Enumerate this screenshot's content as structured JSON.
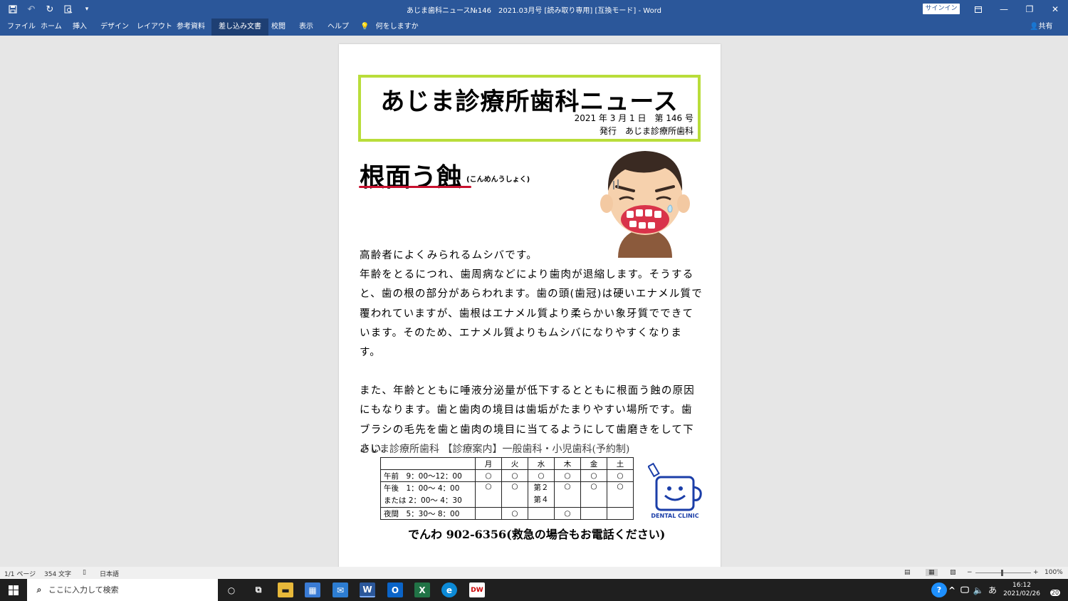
{
  "window": {
    "title": "あじま歯科ニュース№146　2021.03月号 [読み取り専用] [互換モード]  -  Word",
    "signin": "サインイン"
  },
  "ribbon": {
    "tabs": [
      "ファイル",
      "ホーム",
      "挿入",
      "デザイン",
      "レイアウト",
      "参考資料",
      "差し込み文書",
      "校閲",
      "表示",
      "ヘルプ"
    ],
    "tellme": "何をしますか",
    "share": "共有",
    "active_tab": "差し込み文書"
  },
  "document": {
    "masthead": "あじま診療所歯科ニュース",
    "date_line": "2021 年 3 月 1 日　第 146 号",
    "publisher_line": "発行　あじま診療所歯科",
    "heading": "根面う蝕",
    "heading_ruby": "(こんめんうしょく)",
    "paragraphs": [
      "高齢者によくみられるムシバです。",
      "年齢をとるにつれ、歯周病などにより歯肉が退縮します。そうすると、歯の根の部分があらわれます。歯の頭(歯冠)は硬いエナメル質で覆われていますが、歯根はエナメル質より柔らかい象牙質でできています。そのため、エナメル質よりもムシバになりやすくなります。",
      "また、年齢とともに唾液分泌量が低下するとともに根面う蝕の原因にもなります。歯と歯肉の境目は歯垢がたまりやすい場所です。歯ブラシの毛先を歯と歯肉の境目に当てるようにして歯磨きをして下さい。"
    ],
    "clinic_line": "あじま診療所歯科 【診療案内】一般歯科・小児歯科(予約制)",
    "schedule": {
      "days": [
        "月",
        "火",
        "水",
        "木",
        "金",
        "土"
      ],
      "am_label": "午前　9：00〜12：00",
      "am": [
        "○",
        "○",
        "○",
        "○",
        "○",
        "○"
      ],
      "pm_label1": "午後　1：00〜 4：00",
      "pm_label2": "または 2：00〜 4：30",
      "pm": [
        "○",
        "○",
        "第２",
        "○",
        "○",
        "○"
      ],
      "pm_extra_wed": "第４",
      "night_label": "夜間　5：30〜 8：00",
      "night": [
        "",
        "○",
        "",
        "○",
        "",
        ""
      ]
    },
    "phone": "でんわ 902-6356(救急の場合もお電話ください)",
    "logo_text": "DENTAL CLINIC"
  },
  "statusbar": {
    "page": "1/1 ページ",
    "words": "354 文字",
    "lang": "日本語",
    "zoom": "100%"
  },
  "taskbar": {
    "search_placeholder": "ここに入力して検索",
    "time": "16:12",
    "date": "2021/02/26",
    "ime": "あ",
    "notif": "20"
  }
}
